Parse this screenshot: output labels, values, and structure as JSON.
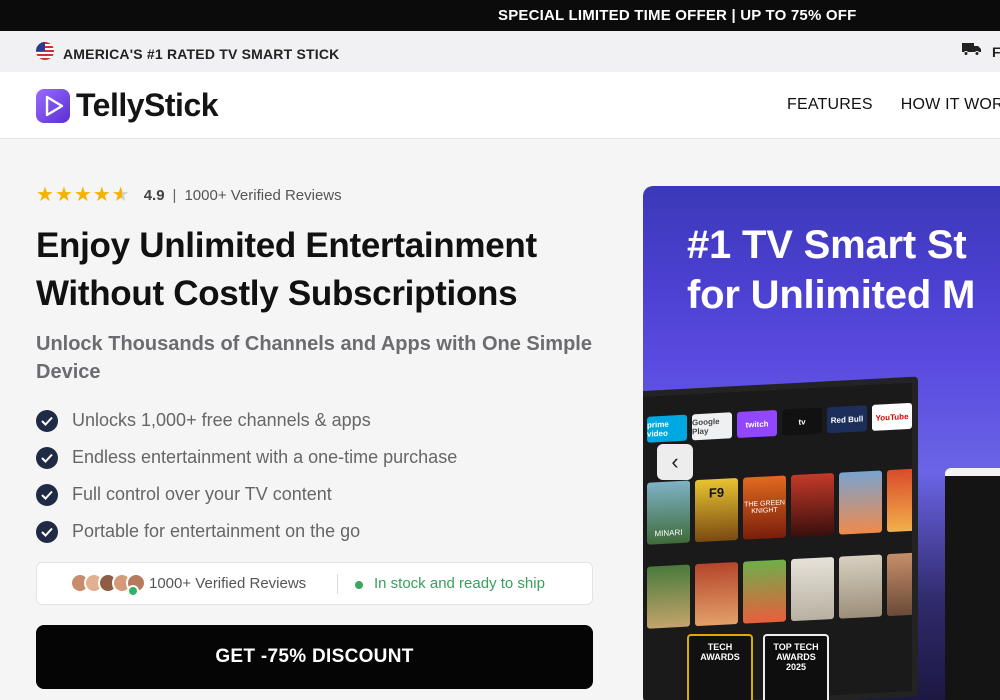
{
  "offer_bar": {
    "text": "SPECIAL LIMITED TIME OFFER | UP TO 75% OFF"
  },
  "sub_bar": {
    "left_text": "AMERICA'S #1 RATED TV SMART STICK",
    "right_text": "FA"
  },
  "header": {
    "logo_text": "TellyStick",
    "nav": [
      "FEATURES",
      "HOW IT WORKS"
    ]
  },
  "rating": {
    "score": "4.9",
    "separator": "|",
    "reviews_text": "1000+ Verified Reviews",
    "stars_value": 4.5
  },
  "hero_text": {
    "headline": "Enjoy Unlimited Entertainment Without Costly Subscriptions",
    "subheadline": "Unlock Thousands of Channels and Apps with One Simple Device"
  },
  "features": [
    "Unlocks 1,000+ free channels & apps",
    "Endless entertainment with a one-time purchase",
    "Full control over your TV content",
    "Portable for entertainment on the go"
  ],
  "stock_box": {
    "reviews_text": "1000+ Verified Reviews",
    "stock_text": "In stock and ready to ship"
  },
  "cta": {
    "label": "GET -75% DISCOUNT"
  },
  "hero_image": {
    "title_line1": "#1 TV Smart St",
    "title_line2": "for Unlimited M",
    "apps": [
      "prime video",
      "Google Play",
      "twitch",
      "tv",
      "Red Bull",
      "YouTube"
    ],
    "posters": [
      "MINARI",
      "F9",
      "THE GREEN KNIGHT"
    ],
    "badge_1_text": "TECH AWARDS",
    "badge_2_text": "TOP TECH AWARDS 2025"
  },
  "colors": {
    "accent": "#5a2fd1",
    "check_bg": "#1f2a44",
    "star": "#f5b301",
    "stock_green": "#3a9e5d",
    "cta_bg": "#050505"
  },
  "icons": [
    "us-flag-icon",
    "truck-icon",
    "logo-play-icon",
    "star-icon",
    "check-icon",
    "chevron-left-icon"
  ]
}
